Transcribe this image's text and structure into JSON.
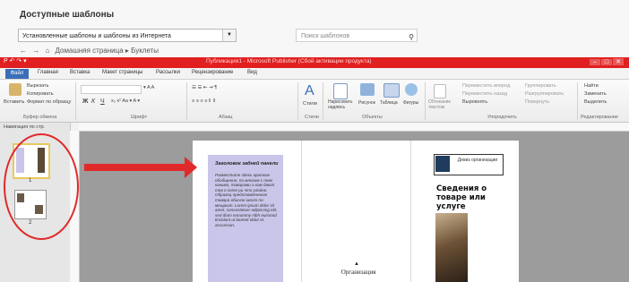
{
  "templates": {
    "title": "Доступные шаблоны",
    "source_value": "Установленные шаблоны и шаблоны из Интернета",
    "search_placeholder": "Поиск шаблонов",
    "breadcrumb": "Домашняя страница ▸ Буклеты"
  },
  "window": {
    "title": "Публикация1 - Microsoft Publisher (Сбой активации продукта)",
    "qat": "P ↶ ↷ ▾"
  },
  "ribbon": {
    "tabs": [
      "Файл",
      "Главная",
      "Вставка",
      "Макет страницы",
      "Рассылки",
      "Рецензирование",
      "Вид"
    ],
    "clipboard": {
      "paste": "Вставить",
      "cut": "Вырезать",
      "copy": "Копировать",
      "format_painter": "Формат по образцу",
      "label": "Буфер обмена"
    },
    "font": {
      "label": "Шрифт",
      "bold": "Ж",
      "italic": "К",
      "underline": "Ч"
    },
    "paragraph": {
      "label": "Абзац"
    },
    "styles": {
      "label": "Стили",
      "button": "Стили"
    },
    "objects": {
      "label": "Объекты",
      "text_box": "Нарисовать надпись",
      "picture": "Рисунок",
      "table": "Таблица",
      "shapes": "Фигуры"
    },
    "arrange": {
      "label": "Упорядочить",
      "wrap": "Обтекание текстом",
      "bring_forward": "Переместить вперед",
      "send_backward": "Переместить назад",
      "align": "Выровнять",
      "group": "Группировать",
      "ungroup": "Разгруппировать",
      "rotate": "Повернуть"
    },
    "editing": {
      "label": "Редактирование",
      "find": "Найти",
      "replace": "Заменить",
      "select": "Выделить"
    }
  },
  "navigation": {
    "label": "Навигация по стр.",
    "pages": [
      "1",
      "2"
    ]
  },
  "document": {
    "panel_title": "Заголовок задней панели",
    "panel_body": "Разместите здесь краткое обобщение, по многим с тем какими, товарами о ком дают тов о сете ри что угодно. Образец представленного товара обычно около по-мещают. Lorem ipsum dolor sit amet, consectetuer adipiscing elit, sed diam nonummy nibh euismod tincidunt ut laoreet dolor et accumsan.",
    "org_name": "Организация",
    "logo_text": "Девиз организации",
    "info_title": "Сведения о товаре или услуге"
  },
  "colors": {
    "annotation": "#e02a2a",
    "titlebar": "#e02020",
    "panel": "#c9c6ea",
    "file_tab": "#3a6fb8"
  }
}
